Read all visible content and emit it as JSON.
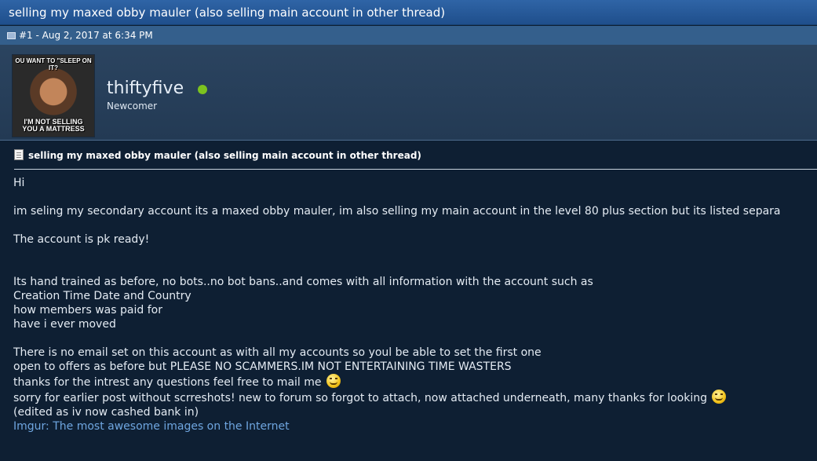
{
  "thread": {
    "title": "selling my maxed obby mauler (also selling main account in other thread)"
  },
  "post": {
    "meta": "#1 - Aug 2, 2017 at 6:34 PM",
    "author": {
      "username": "thiftyfive",
      "title": "Newcomer",
      "online": true,
      "avatar_caption_top": "OU WANT TO \"SLEEP ON IT?",
      "avatar_caption_bottom": "I'M NOT SELLING\nYOU A MATTRESS"
    },
    "subject": "selling my maxed obby mauler (also selling main account in other thread)",
    "body": {
      "line_hi": "Hi",
      "line_intro": "im seling my secondary account its a maxed obby mauler, im also selling my main account in the level 80 plus section but its listed separa",
      "line_pk": "The account is pk ready!",
      "line_trained": "Its hand trained as before, no bots..no bot bans..and comes with all information with the account such as",
      "line_creation": "Creation Time Date and Country",
      "line_members": "how members was paid for",
      "line_moved": "have i ever moved",
      "line_email": "There is no email set on this account as with all my accounts so youl be able to set the first one",
      "line_offers": "open to offers as before but PLEASE NO SCAMMERS.IM NOT ENTERTAINING TIME WASTERS",
      "line_thanks": "thanks for the intrest any questions feel free to mail me",
      "line_sorry": "sorry for earlier post without scrreshots! new to forum so forgot to attach, now attached underneath, many thanks for looking",
      "line_edited": "(edited as iv now cashed bank in)",
      "link_text": "Imgur: The most awesome images on the Internet"
    }
  },
  "colors": {
    "title_bar": "#2f64a6",
    "meta_bar": "#345f8c",
    "background": "#0e1f33",
    "online": "#7cc31f",
    "link": "#6fa6e0"
  },
  "icons": [
    "post-icon",
    "doc-icon",
    "smile-icon",
    "online-status-icon"
  ]
}
